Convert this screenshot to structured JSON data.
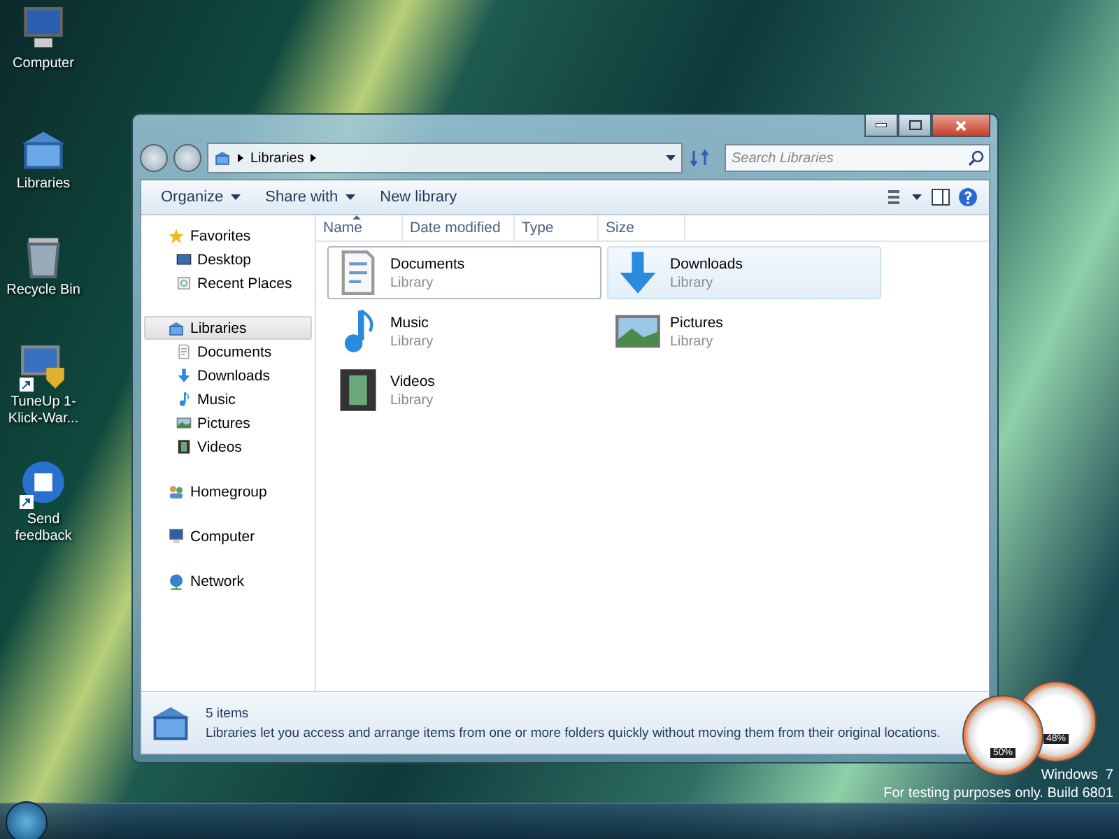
{
  "desktop_icons": [
    {
      "label": "Computer",
      "kind": "computer"
    },
    {
      "label": "Libraries",
      "kind": "library"
    },
    {
      "label": "Recycle Bin",
      "kind": "bin"
    },
    {
      "label": "TuneUp 1-Klick-War...",
      "kind": "tuneup",
      "shortcut": true
    },
    {
      "label": "Send feedback",
      "kind": "feedback",
      "shortcut": true
    }
  ],
  "window": {
    "breadcrumb": "Libraries",
    "search": {
      "placeholder": "Search Libraries"
    },
    "toolbar": [
      {
        "label": "Organize",
        "dropdown": true
      },
      {
        "label": "Share with",
        "dropdown": true
      },
      {
        "label": "New library",
        "dropdown": false
      }
    ],
    "sidebar": [
      {
        "label": "Favorites",
        "kind": "star",
        "selected": false,
        "children": [
          {
            "label": "Desktop",
            "kind": "desktop",
            "selected": false
          },
          {
            "label": "Recent Places",
            "kind": "recent",
            "selected": false
          }
        ]
      },
      {
        "label": "Libraries",
        "kind": "library",
        "selected": true,
        "children": [
          {
            "label": "Documents",
            "kind": "documents",
            "selected": false
          },
          {
            "label": "Downloads",
            "kind": "downloads",
            "selected": false
          },
          {
            "label": "Music",
            "kind": "music",
            "selected": false
          },
          {
            "label": "Pictures",
            "kind": "pictures",
            "selected": false
          },
          {
            "label": "Videos",
            "kind": "videos",
            "selected": false
          }
        ]
      },
      {
        "label": "Homegroup",
        "kind": "homegroup",
        "selected": false
      },
      {
        "label": "Computer",
        "kind": "computer",
        "selected": false
      },
      {
        "label": "Network",
        "kind": "network",
        "selected": false
      }
    ],
    "columns": [
      {
        "label": "Name",
        "sorted": true
      },
      {
        "label": "Date modified",
        "sorted": false
      },
      {
        "label": "Type",
        "sorted": false
      },
      {
        "label": "Size",
        "sorted": false
      }
    ],
    "items": [
      {
        "name": "Documents",
        "type": "Library",
        "kind": "documents",
        "focused": true,
        "hovered": false
      },
      {
        "name": "Downloads",
        "type": "Library",
        "kind": "downloads",
        "focused": false,
        "hovered": true
      },
      {
        "name": "Music",
        "type": "Library",
        "kind": "music",
        "focused": false,
        "hovered": false
      },
      {
        "name": "Pictures",
        "type": "Library",
        "kind": "pictures",
        "focused": false,
        "hovered": false
      },
      {
        "name": "Videos",
        "type": "Library",
        "kind": "videos",
        "focused": false,
        "hovered": false
      }
    ],
    "details": {
      "count": "5 items",
      "description": "Libraries let you access and arrange items from one or more folders quickly without moving them from their original locations."
    }
  },
  "gadgets": [
    {
      "reading": "50%"
    },
    {
      "reading": "48%"
    }
  ],
  "build_notice": {
    "edition": "Windows  7",
    "build": "For testing purposes only. Build 6801"
  }
}
